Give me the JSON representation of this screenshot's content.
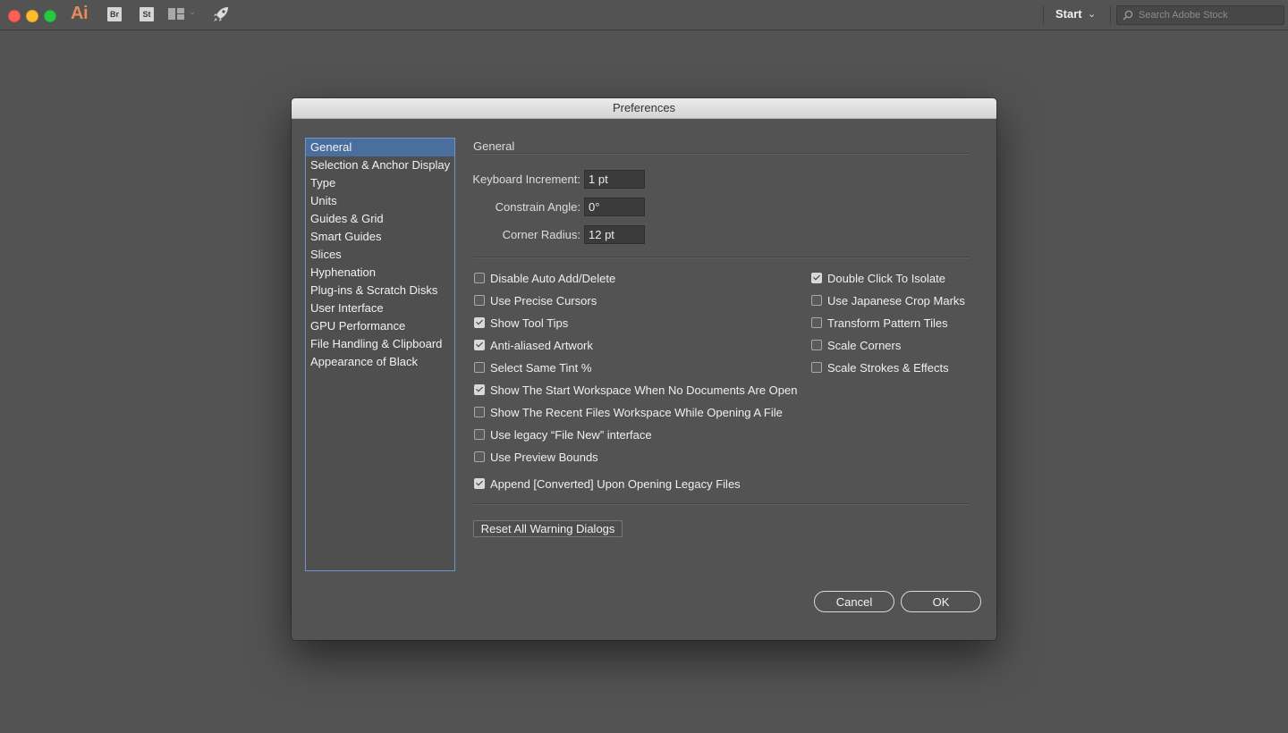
{
  "app": {
    "logo": "Ai",
    "bridge_label": "Br",
    "stock_label": "St",
    "workspace_label": "Start",
    "stock_search_placeholder": "Search Adobe Stock"
  },
  "dialog": {
    "title": "Preferences",
    "sidebar": [
      {
        "label": "General",
        "active": true
      },
      {
        "label": "Selection & Anchor Display"
      },
      {
        "label": "Type"
      },
      {
        "label": "Units"
      },
      {
        "label": "Guides & Grid"
      },
      {
        "label": "Smart Guides"
      },
      {
        "label": "Slices"
      },
      {
        "label": "Hyphenation"
      },
      {
        "label": "Plug-ins & Scratch Disks"
      },
      {
        "label": "User Interface"
      },
      {
        "label": "GPU Performance"
      },
      {
        "label": "File Handling & Clipboard"
      },
      {
        "label": "Appearance of Black"
      }
    ],
    "section_title": "General",
    "fields": [
      {
        "label": "Keyboard Increment:",
        "value": "1 pt"
      },
      {
        "label": "Constrain Angle:",
        "value": "0°"
      },
      {
        "label": "Corner Radius:",
        "value": "12 pt"
      }
    ],
    "left_options": [
      {
        "label": "Disable Auto Add/Delete",
        "checked": false
      },
      {
        "label": "Use Precise Cursors",
        "checked": false
      },
      {
        "label": "Show Tool Tips",
        "checked": true
      },
      {
        "label": "Anti-aliased Artwork",
        "checked": true
      },
      {
        "label": "Select Same Tint %",
        "checked": false
      },
      {
        "label": "Show The Start Workspace When No Documents Are Open",
        "checked": true
      },
      {
        "label": "Show The Recent Files Workspace While Opening A File",
        "checked": false
      },
      {
        "label": "Use legacy “File New” interface",
        "checked": false
      },
      {
        "label": "Use Preview Bounds",
        "checked": false
      },
      {
        "label": "Append [Converted] Upon Opening Legacy Files",
        "checked": true
      }
    ],
    "right_options": [
      {
        "label": "Double Click To Isolate",
        "checked": true
      },
      {
        "label": "Use Japanese Crop Marks",
        "checked": false
      },
      {
        "label": "Transform Pattern Tiles",
        "checked": false
      },
      {
        "label": "Scale Corners",
        "checked": false
      },
      {
        "label": "Scale Strokes & Effects",
        "checked": false
      }
    ],
    "reset_label": "Reset All Warning Dialogs",
    "cancel_label": "Cancel",
    "ok_label": "OK"
  },
  "colors": {
    "window_bg": "#535353",
    "sidebar_selection": "#4a6f9e",
    "sidebar_border": "#6d95c9",
    "ai_brand": "#e6895c"
  },
  "icons": [
    "close-dot",
    "minimize-dot",
    "maximize-dot",
    "bridge-icon",
    "stock-icon",
    "workspace-layout-icon",
    "rocket-icon",
    "chevron-down-icon",
    "search-icon"
  ]
}
